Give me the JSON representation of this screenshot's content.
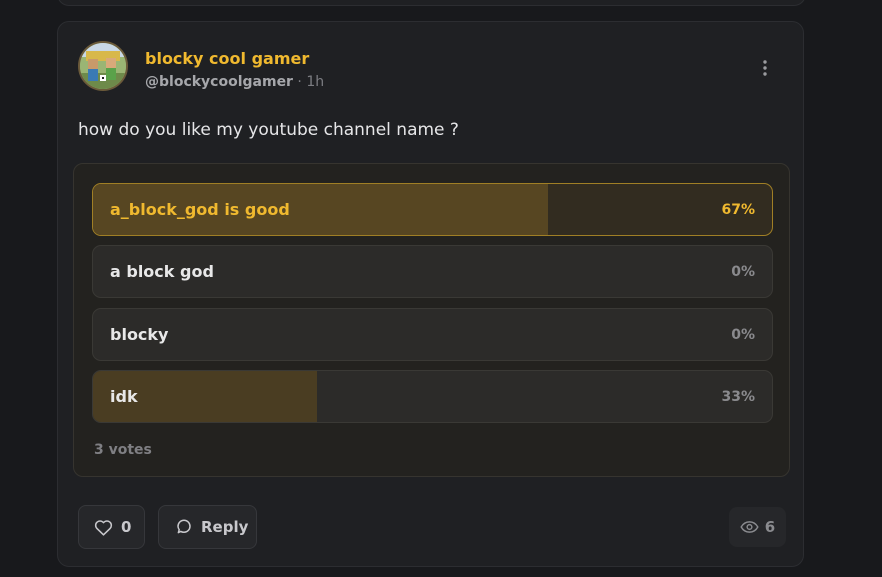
{
  "post": {
    "author_name": "blocky cool gamer",
    "handle": "@blockycoolgamer",
    "separator": "·",
    "time": "1h",
    "text": "how do you like my youtube channel name ?"
  },
  "poll": {
    "options": [
      {
        "label": "a_block_god is good",
        "percent_text": "67%",
        "percent": 0.67,
        "selected": true
      },
      {
        "label": "a block god",
        "percent_text": "0%",
        "percent": 0.0,
        "selected": false
      },
      {
        "label": "blocky",
        "percent_text": "0%",
        "percent": 0.0,
        "selected": false
      },
      {
        "label": "idk",
        "percent_text": "33%",
        "percent": 0.33,
        "selected": false
      }
    ],
    "votes_text": "3 votes"
  },
  "actions": {
    "like_count": "0",
    "reply_label": "Reply",
    "views_count": "6"
  },
  "icons": {
    "more": "more-vertical-icon",
    "like": "heart-icon",
    "reply": "chat-bubble-icon",
    "views": "eye-icon"
  },
  "colors": {
    "accent": "#f0b92f",
    "background": "#18191c",
    "card": "#1f2023"
  }
}
